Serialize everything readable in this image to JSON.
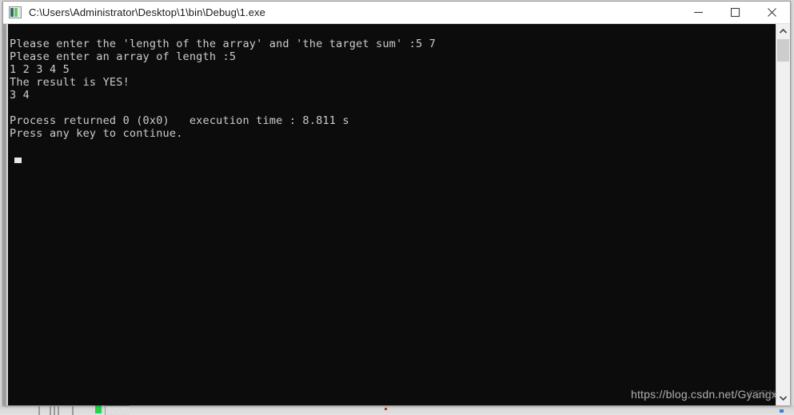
{
  "window": {
    "title": "C:\\Users\\Administrator\\Desktop\\1\\bin\\Debug\\1.exe",
    "icon": "console-app-icon",
    "controls": {
      "minimize_label": "Minimize",
      "maximize_label": "Maximize",
      "close_label": "Close"
    }
  },
  "console": {
    "prompt_length_target": "Please enter the 'length of the array' and 'the target sum' :5 7",
    "prompt_array": "Please enter an array of length :5",
    "array_input": "1 2 3 4 5",
    "result_line": "The result is YES!",
    "indices_line": "3 4",
    "blank_line": "",
    "process_returned": "Process returned 0 (0x0)   execution time : 8.811 s",
    "press_any_key": "Press any key to continue.",
    "full_text": "Please enter the 'length of the array' and 'the target sum' :5 7\nPlease enter an array of length :5\n1 2 3 4 5\nThe result is YES!\n3 4\n\nProcess returned 0 (0x0)   execution time : 8.811 s\nPress any key to continue.",
    "background_color": "#0c0c0c",
    "text_color": "#cccccc"
  },
  "scrollbar": {
    "up_arrow": "scroll-up-arrow",
    "down_arrow": "scroll-down-arrow",
    "thumb": "scroll-thumb"
  },
  "watermark": {
    "url": "https://blog.csdn.net/Gyangx",
    "badge": "CSDN"
  }
}
